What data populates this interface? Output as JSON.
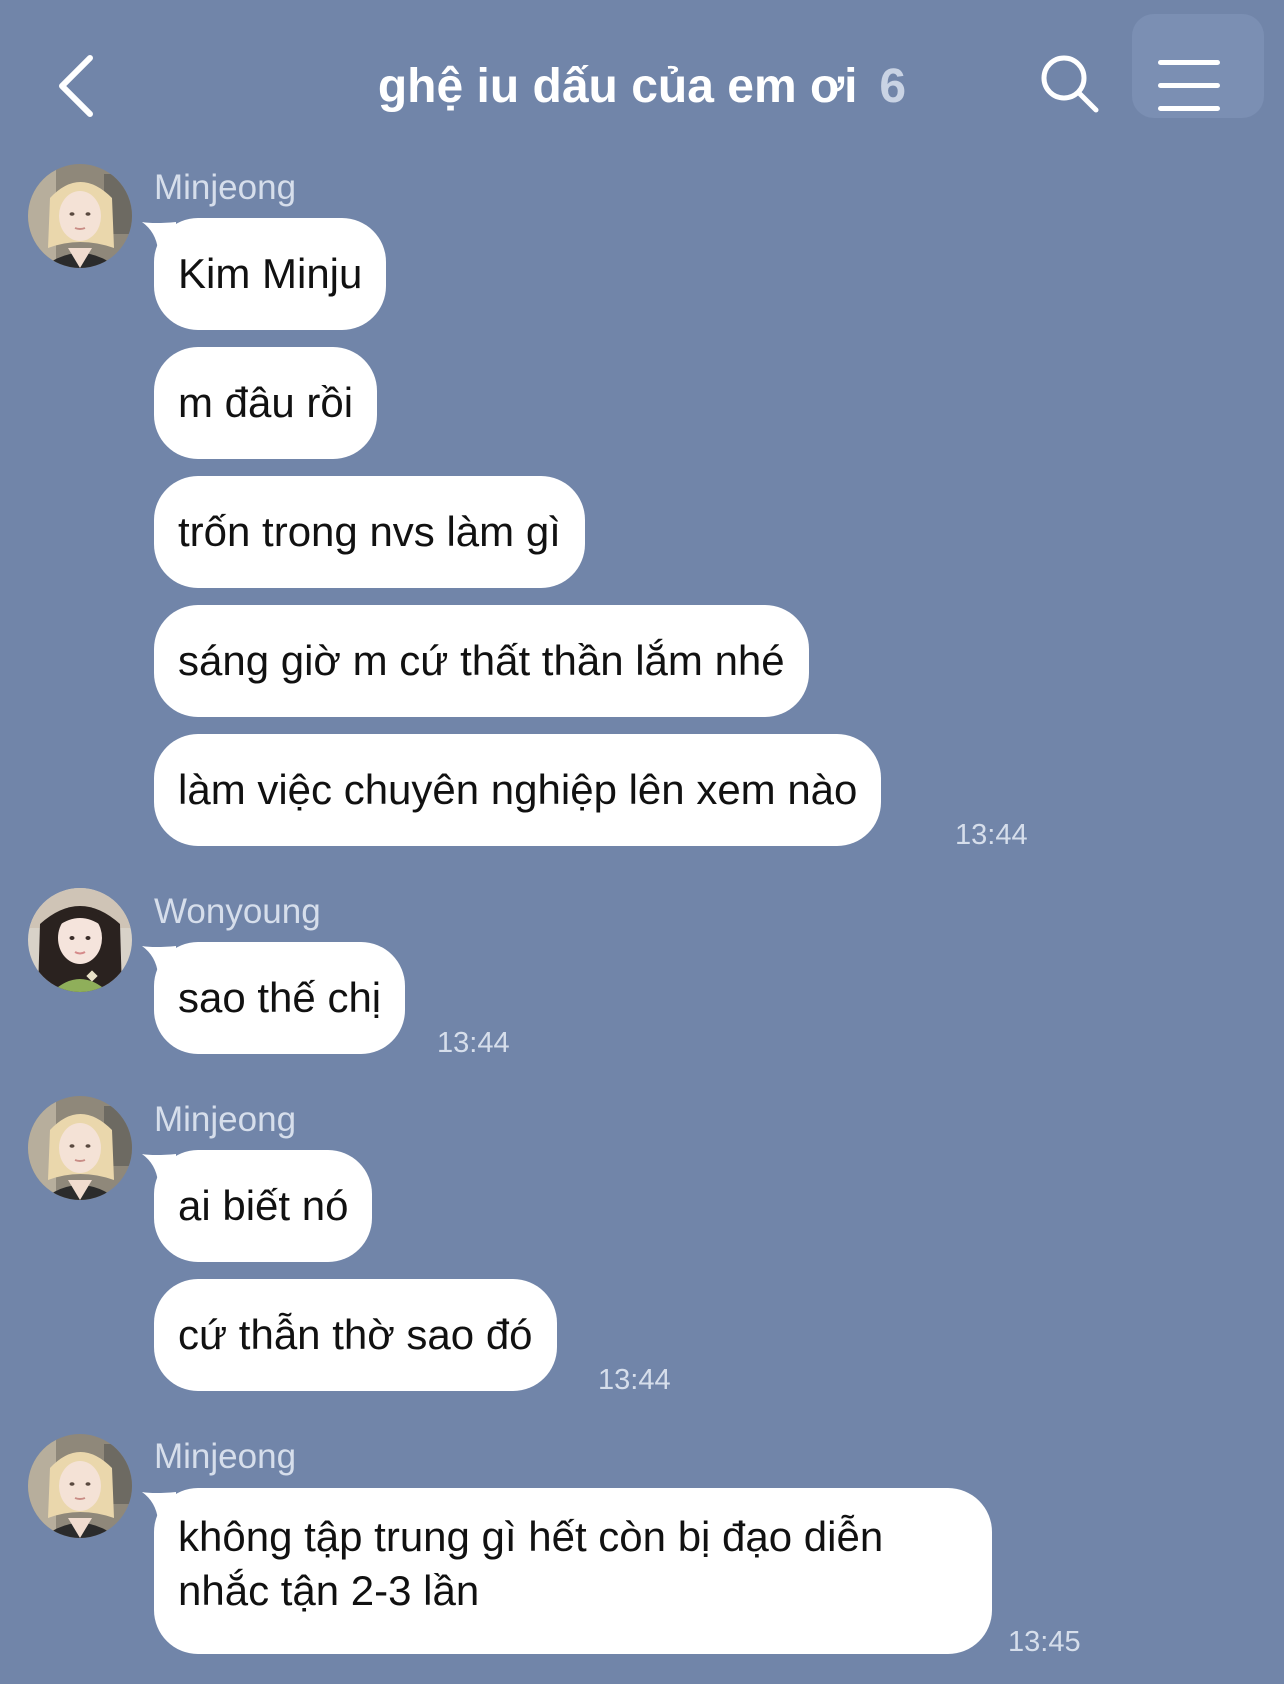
{
  "header": {
    "title": "ghệ iu dấu của em ơi",
    "member_count": "6",
    "back_icon": "chevron-left-icon",
    "search_icon": "search-icon",
    "menu_icon": "hamburger-menu-icon"
  },
  "messages": [
    {
      "sender": "Minjeong",
      "text": "Kim Minju"
    },
    {
      "text": "m đâu rồi"
    },
    {
      "text": "trốn trong nvs làm gì"
    },
    {
      "text": "sáng giờ m cứ thất thần lắm nhé"
    },
    {
      "text": "làm việc chuyên nghiệp lên xem nào",
      "time": "13:44"
    },
    {
      "sender": "Wonyoung",
      "text": "sao thế chị",
      "time": "13:44"
    },
    {
      "sender": "Minjeong",
      "text": "ai biết nó"
    },
    {
      "text": "cứ thẫn thờ sao đó",
      "time": "13:44"
    },
    {
      "sender": "Minjeong",
      "text": "không tập trung gì hết còn bị đạo diễn nhắc tận 2-3 lần",
      "time": "13:45"
    }
  ],
  "colors": {
    "background": "#7185a9",
    "bubble": "#ffffff",
    "meta_text": "#d6deeb"
  }
}
